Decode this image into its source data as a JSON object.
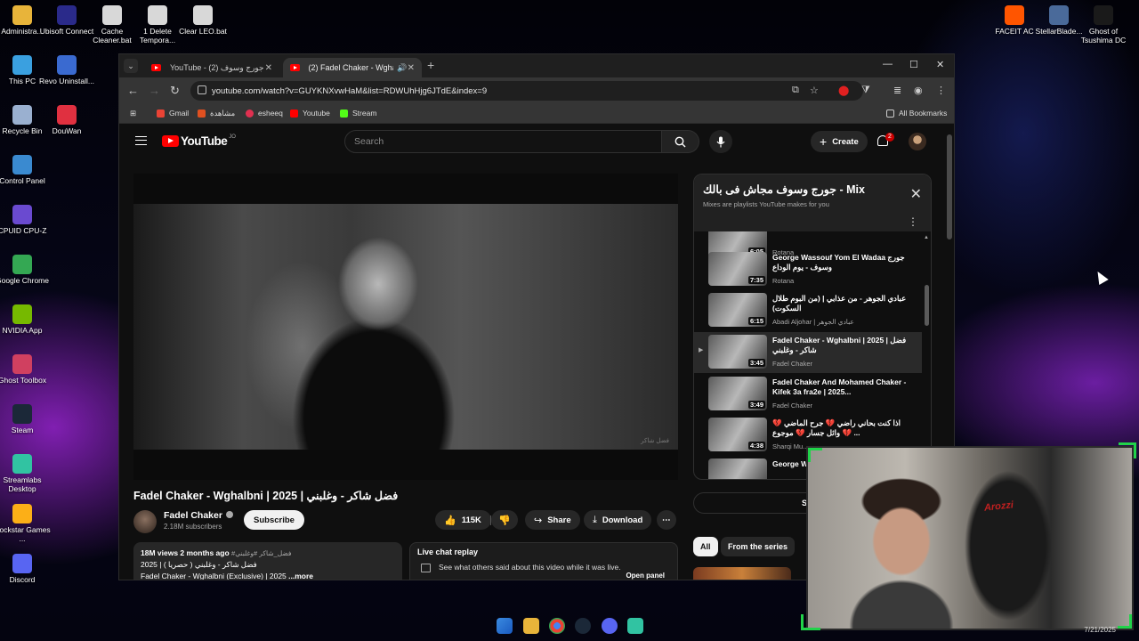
{
  "desktop": {
    "left_icons": [
      {
        "label": "Administra...",
        "icon": "folder-icon",
        "color": "#e8b43a"
      },
      {
        "label": "Ubisoft Connect",
        "icon": "ubisoft-icon",
        "color": "#2a2a8a"
      },
      {
        "label": "Cache Cleaner.bat",
        "icon": "bat-file-icon",
        "color": "#d8d8d8"
      },
      {
        "label": "1 Delete Tempora...",
        "icon": "bat-file-icon",
        "color": "#d8d8d8"
      },
      {
        "label": "Clear LEO.bat",
        "icon": "bat-file-icon",
        "color": "#d8d8d8"
      },
      {
        "label": "This PC",
        "icon": "monitor-icon",
        "color": "#3aa0e0"
      },
      {
        "label": "Revo Uninstall...",
        "icon": "revo-icon",
        "color": "#3a6ad0"
      },
      {
        "label": "Recycle Bin",
        "icon": "recycle-bin-icon",
        "color": "#9ab0d0"
      },
      {
        "label": "DouWan",
        "icon": "douwan-icon",
        "color": "#e03040"
      },
      {
        "label": "Control Panel",
        "icon": "control-panel-icon",
        "color": "#3a8ad0"
      },
      {
        "label": "CPUID CPU-Z",
        "icon": "cpuz-icon",
        "color": "#6a4ad0"
      },
      {
        "label": "Google Chrome",
        "icon": "chrome-icon",
        "color": "#34a853"
      },
      {
        "label": "NVIDIA App",
        "icon": "nvidia-icon",
        "color": "#76b900"
      },
      {
        "label": "Ghost Toolbox",
        "icon": "ghost-toolbox-icon",
        "color": "#d04060"
      },
      {
        "label": "Steam",
        "icon": "steam-icon",
        "color": "#1b2838"
      },
      {
        "label": "Streamlabs Desktop",
        "icon": "streamlabs-icon",
        "color": "#31c3a2"
      },
      {
        "label": "Rockstar Games ...",
        "icon": "rockstar-icon",
        "color": "#fcaf17"
      },
      {
        "label": "Discord",
        "icon": "discord-icon",
        "color": "#5865f2"
      }
    ],
    "right_icons": [
      {
        "label": "FACEIT AC",
        "icon": "faceit-icon",
        "color": "#ff5500"
      },
      {
        "label": "StellarBlade...",
        "icon": "stellar-blade-icon",
        "color": "#4a6a9a"
      },
      {
        "label": "Ghost of Tsushima DC",
        "icon": "ghost-tsushima-icon",
        "color": "#1a1a1a"
      }
    ],
    "taskbar_date": "7/21/2025"
  },
  "browser": {
    "tabs": [
      {
        "title": "YouTube - جورج وسوف (2)",
        "active": false
      },
      {
        "title": "(2) Fadel Chaker - Wghalbni",
        "active": true
      }
    ],
    "url": "youtube.com/watch?v=GUYKNXvwHaM&list=RDWUhHjg6JTdE&index=9",
    "bookmarks": [
      {
        "label": "Gmail",
        "color": "#ea4335"
      },
      {
        "label": "مشاهدة",
        "color": "#e05020"
      },
      {
        "label": "esheeq",
        "color": "#e03050"
      },
      {
        "label": "Youtube",
        "color": "#ff0000"
      },
      {
        "label": "Stream",
        "color": "#53fc18"
      }
    ],
    "all_bookmarks": "All Bookmarks"
  },
  "youtube": {
    "logo": "YouTube",
    "country_code": "JO",
    "search_placeholder": "Search",
    "create_label": "Create",
    "notification_count": "2",
    "video": {
      "title": "Fadel Chaker - Wghalbni | 2025 | فضل شاكر - وغلبني",
      "watermark": "فضل شاكر",
      "channel": "Fadel Chaker",
      "subscribers": "2.18M subscribers",
      "subscribe_label": "Subscribe",
      "likes": "115K",
      "share_label": "Share",
      "download_label": "Download",
      "desc_meta": "18M views  2 months ago",
      "desc_tags": "#فضل_شاكر #وغلبني",
      "desc_line2": "2025 | فضل شاكر - وغلبني ( حصريا )",
      "desc_line3": "Fadel Chaker - Wghalbni (Exclusive) | 2025",
      "desc_more": "...more"
    },
    "live_chat": {
      "title": "Live chat replay",
      "subtitle": "See what others said about this video while it was live.",
      "open_panel": "Open panel"
    },
    "playlist": {
      "title": "جورج وسوف مجاش فى بالك - Mix",
      "subtitle": "Mixes are playlists YouTube makes for you",
      "items": [
        {
          "title": "",
          "channel": "Rotana",
          "duration": "6:05",
          "active": false
        },
        {
          "title": "George Wassouf Yom El Wadaa جورج وسوف - يوم الوداع",
          "channel": "Rotana",
          "duration": "7:35",
          "active": false
        },
        {
          "title": "عبادي الجوهر - من عذابي | (من البوم طلال السكوت)",
          "channel": "Abadi Aljohar | عبادي الجوهر",
          "duration": "6:15",
          "active": false
        },
        {
          "title": "Fadel Chaker - Wghalbni | 2025 | فضل شاكر - وغلبني",
          "channel": "Fadel Chaker",
          "duration": "3:45",
          "active": true
        },
        {
          "title": "Fadel Chaker And Mohamed Chaker - Kifek 3a fra2e | 2025...",
          "channel": "Fadel Chaker",
          "duration": "3:49",
          "active": false
        },
        {
          "title": "اذا كنت بحاني راضي 💔 جرح الماضي 💔 وائل جسار 💔 موجوع 💔 ...",
          "channel": "Sharqi Mu...",
          "duration": "4:38",
          "active": false
        },
        {
          "title": "George W... Koul El N...",
          "channel": "",
          "duration": "",
          "active": false
        }
      ]
    },
    "show_label": "Show",
    "chips": [
      "All",
      "From the series"
    ]
  }
}
